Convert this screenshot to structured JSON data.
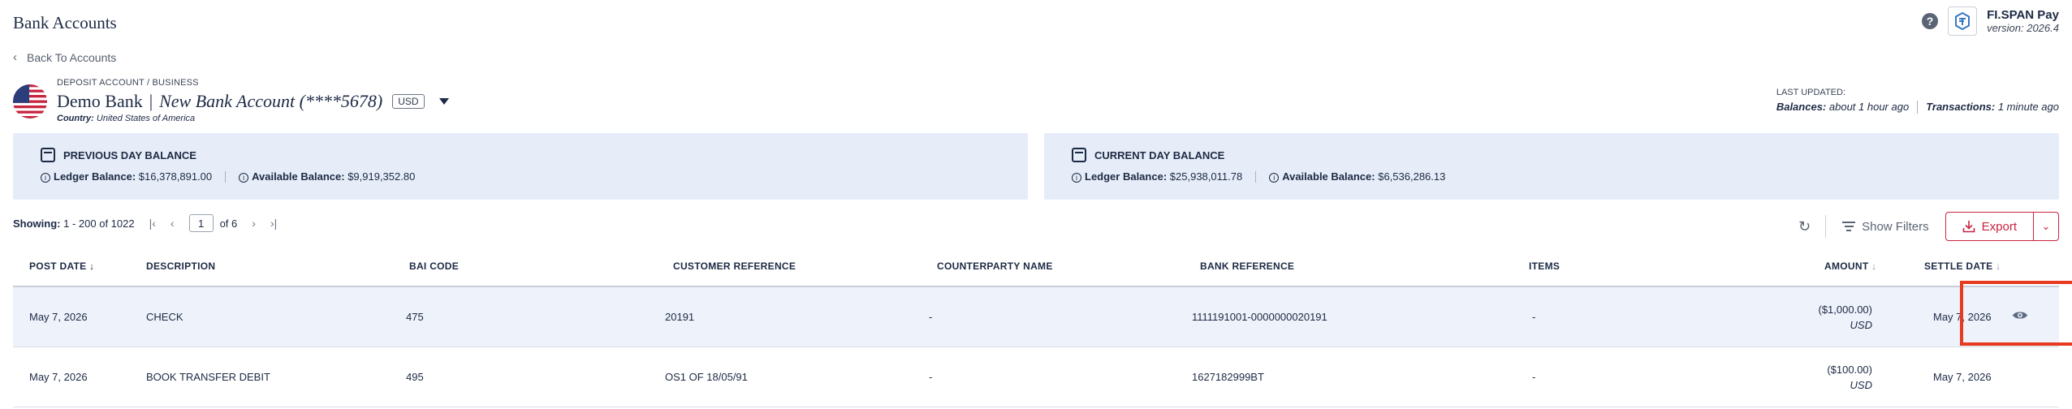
{
  "header": {
    "title": "Bank Accounts",
    "back_label": "Back To Accounts",
    "brand_name": "FI.SPAN Pay",
    "brand_version": "version: 2026.4"
  },
  "account": {
    "type": "DEPOSIT ACCOUNT / BUSINESS",
    "bank": "Demo Bank",
    "separator": "|",
    "name": "New Bank Account (****5678)",
    "currency": "USD",
    "country_label": "Country:",
    "country": "United States of America"
  },
  "last_updated": {
    "label": "LAST UPDATED:",
    "balances_label": "Balances:",
    "balances_value": "about 1 hour ago",
    "transactions_label": "Transactions:",
    "transactions_value": "1 minute ago"
  },
  "balances": {
    "previous": {
      "title": "PREVIOUS DAY BALANCE",
      "ledger_label": "Ledger Balance:",
      "ledger_value": "$16,378,891.00",
      "available_label": "Available Balance:",
      "available_value": "$9,919,352.80"
    },
    "current": {
      "title": "CURRENT DAY BALANCE",
      "ledger_label": "Ledger Balance:",
      "ledger_value": "$25,938,011.78",
      "available_label": "Available Balance:",
      "available_value": "$6,536,286.13"
    }
  },
  "toolbar": {
    "showing_label": "Showing:",
    "showing_value": "1 - 200 of 1022",
    "page": "1",
    "of_pages": "of 6",
    "show_filters": "Show Filters",
    "export": "Export"
  },
  "table": {
    "headers": {
      "post_date": "POST DATE",
      "description": "DESCRIPTION",
      "bai_code": "BAI CODE",
      "customer_reference": "CUSTOMER REFERENCE",
      "counterparty_name": "COUNTERPARTY NAME",
      "bank_reference": "BANK REFERENCE",
      "items": "ITEMS",
      "amount": "AMOUNT",
      "settle_date": "SETTLE DATE"
    },
    "rows": [
      {
        "post_date": "May 7, 2026",
        "description": "CHECK",
        "bai_code": "475",
        "customer_reference": "20191",
        "counterparty_name": "-",
        "bank_reference": "1111191001-0000000020191",
        "items": "-",
        "amount": "($1,000.00)",
        "currency": "USD",
        "settle_date": "May 7, 2026"
      },
      {
        "post_date": "May 7, 2026",
        "description": "BOOK TRANSFER DEBIT",
        "bai_code": "495",
        "customer_reference": "OS1 OF 18/05/91",
        "counterparty_name": "-",
        "bank_reference": "1627182999BT",
        "items": "-",
        "amount": "($100.00)",
        "currency": "USD",
        "settle_date": "May 7, 2026"
      }
    ]
  },
  "colors": {
    "accent": "#c7243f",
    "card_bg": "#e6edf8",
    "highlight_row": "#eef2fa",
    "annotation": "#e83a20"
  }
}
